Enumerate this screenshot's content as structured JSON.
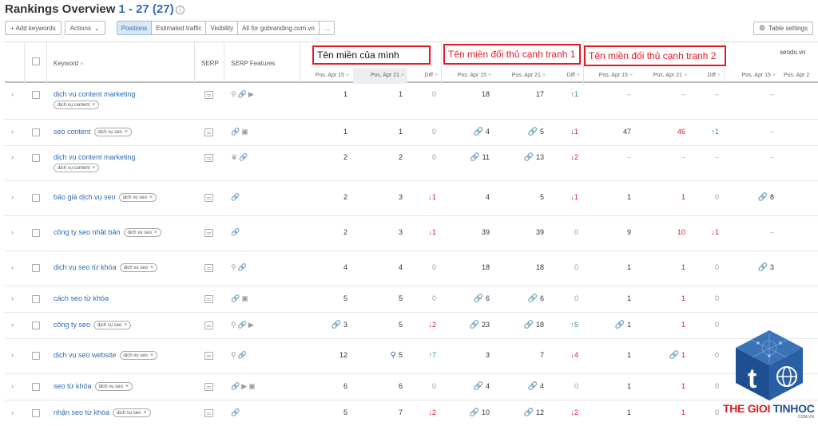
{
  "title": {
    "main": "Rankings Overview",
    "range": "1 - 27 (27)"
  },
  "toolbar": {
    "add_keywords": "+ Add keywords",
    "actions": "Actions",
    "segments": [
      "Positions",
      "Estimated traffic",
      "Visibility",
      "All for gobranding.com.vn",
      "..."
    ],
    "table_settings": "Table settings"
  },
  "headers": {
    "keyword": "Keyword",
    "serp": "SERP",
    "serp_features": "SERP Features",
    "pos_apr15": "Pos. Apr 15",
    "pos_apr21": "Pos. Apr 21",
    "diff": "Diff",
    "pos_apr2_partial": "Pos. Apr 2",
    "domain4": "seodo.vn"
  },
  "annotations": {
    "own": "Tên miền của mình",
    "comp1": "Tên miền đối thủ cạnh tranh 1",
    "comp2": "Tên miền đối thủ cạnh tranh 2"
  },
  "rows": [
    {
      "keyword": "dịch vụ content marketing",
      "tag": "dịch vụ content",
      "tag_below": true,
      "features": [
        "pin",
        "link",
        "video"
      ],
      "d1": [
        "1",
        "1",
        "0"
      ],
      "d2": [
        "18",
        "17",
        "↑1"
      ],
      "d3": [
        "–",
        "–",
        "–"
      ],
      "d4": "–"
    },
    {
      "keyword": "seo content",
      "tag": "dịch vụ seo",
      "tag_below": false,
      "features": [
        "link",
        "image"
      ],
      "d1": [
        "1",
        "1",
        "0"
      ],
      "d2": [
        "4",
        "5",
        "↓1"
      ],
      "d3": [
        "47",
        "46",
        "↑1"
      ],
      "d4": "–"
    },
    {
      "keyword": "dịch vụ content marketing",
      "tag": "dịch vụ content",
      "tag_below": true,
      "features": [
        "crown",
        "link"
      ],
      "d1": [
        "2",
        "2",
        "0"
      ],
      "d2": [
        "11",
        "13",
        "↓2"
      ],
      "d3": [
        "–",
        "–",
        "–"
      ],
      "d4": "–"
    },
    {
      "keyword": "báo giá dịch vụ seo",
      "tag": "dịch vụ seo",
      "tag_below": false,
      "features": [
        "link"
      ],
      "d1": [
        "2",
        "3",
        "↓1"
      ],
      "d2": [
        "4",
        "5",
        "↓1"
      ],
      "d3": [
        "1",
        "1",
        "0"
      ],
      "d4": "8"
    },
    {
      "keyword": "công ty seo nhật bản",
      "tag": "dịch vụ seo",
      "tag_below": false,
      "features": [
        "link"
      ],
      "d1": [
        "2",
        "3",
        "↓1"
      ],
      "d2": [
        "39",
        "39",
        "0"
      ],
      "d3": [
        "9",
        "10",
        "↓1"
      ],
      "d4": "–"
    },
    {
      "keyword": "dịch vụ seo từ khóa",
      "tag": "dịch vụ seo",
      "tag_below": false,
      "features": [
        "pin",
        "link"
      ],
      "d1": [
        "4",
        "4",
        "0"
      ],
      "d2": [
        "18",
        "18",
        "0"
      ],
      "d3": [
        "1",
        "1",
        "0"
      ],
      "d4": "3"
    },
    {
      "keyword": "cách seo từ khóa",
      "tag": "",
      "tag_below": false,
      "features": [
        "link",
        "image"
      ],
      "d1": [
        "5",
        "5",
        "0"
      ],
      "d2": [
        "6",
        "6",
        "0"
      ],
      "d3": [
        "1",
        "1",
        "0"
      ],
      "d4": ""
    },
    {
      "keyword": "công ty seo",
      "tag": "dịch vụ seo",
      "tag_below": false,
      "features": [
        "pin",
        "link",
        "video"
      ],
      "d1": [
        "3",
        "5",
        "↓2"
      ],
      "d2": [
        "23",
        "18",
        "↑5"
      ],
      "d3": [
        "1",
        "1",
        "0"
      ],
      "d4": ""
    },
    {
      "keyword": "dịch vụ seo website",
      "tag": "dịch vụ seo",
      "tag_below": false,
      "features": [
        "pin",
        "link"
      ],
      "d1": [
        "12",
        "5",
        "↑7"
      ],
      "d2": [
        "3",
        "7",
        "↓4"
      ],
      "d3": [
        "1",
        "1",
        "0"
      ],
      "d4": ""
    },
    {
      "keyword": "seo từ khóa",
      "tag": "dịch vụ seo",
      "tag_below": false,
      "features": [
        "link",
        "video",
        "image"
      ],
      "d1": [
        "6",
        "6",
        "0"
      ],
      "d2": [
        "4",
        "4",
        "0"
      ],
      "d3": [
        "1",
        "1",
        "0"
      ],
      "d4": ""
    },
    {
      "keyword": "nhận seo từ khóa",
      "tag": "dịch vụ seo",
      "tag_below": false,
      "features": [
        "link"
      ],
      "d1": [
        "5",
        "7",
        "↓2"
      ],
      "d2": [
        "10",
        "12",
        "↓2"
      ],
      "d3": [
        "1",
        "1",
        "0"
      ],
      "d4": ""
    }
  ],
  "logo": {
    "text_a": "THE GIOI",
    "text_b": "TINHOC",
    "sub": "COM.VN"
  },
  "colors": {
    "link": "#2f6cb3",
    "up": "#2a9d3c",
    "down": "#d21e2b",
    "annotation": "#e31b23",
    "logo_blue": "#1d4f91"
  }
}
